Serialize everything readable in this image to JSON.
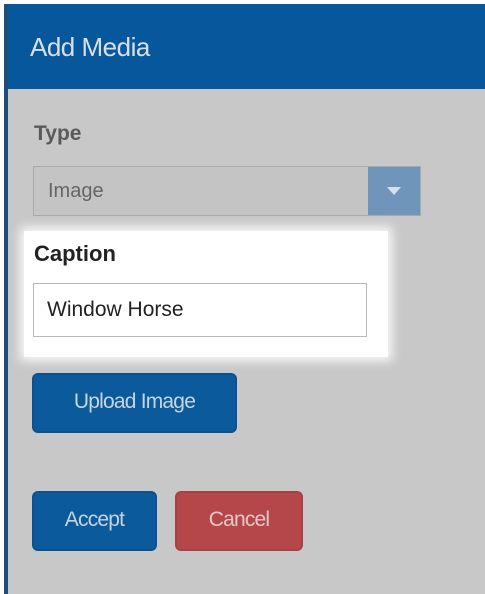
{
  "dialog": {
    "title": "Add Media",
    "type": {
      "label": "Type",
      "selected": "Image"
    },
    "caption": {
      "label": "Caption",
      "value": "Window Horse"
    },
    "buttons": {
      "upload": "Upload Image",
      "accept": "Accept",
      "cancel": "Cancel"
    }
  },
  "colors": {
    "header": "#06579c",
    "primary_button": "#0b5a9c",
    "danger_button": "#b5474b",
    "select_arrow": "#6f95ba",
    "backdrop": "#c8c8c8"
  },
  "icons": {
    "select_arrow": "chevron-down-icon"
  }
}
